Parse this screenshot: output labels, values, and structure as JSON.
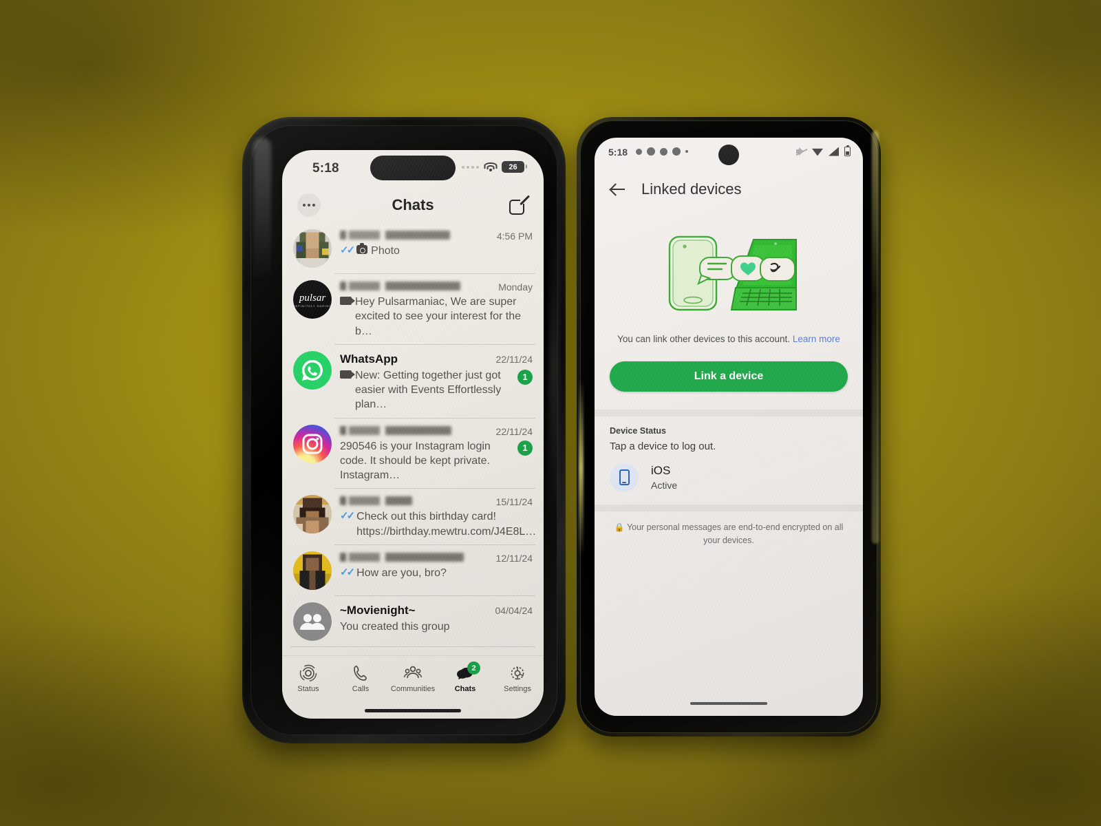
{
  "scene": {
    "background_color": "#9d8c14",
    "description": "Two smartphones side by side on an olive-yellow desk"
  },
  "ios_phone": {
    "status_bar": {
      "time": "5:18",
      "battery_level": "26",
      "icons": [
        "signal-dots-icon",
        "wifi-icon",
        "battery-icon"
      ]
    },
    "nav": {
      "menu_label": "",
      "title": "Chats",
      "compose_label": ""
    },
    "chats": [
      {
        "name": "",
        "name_redacted": true,
        "time": "4:56 PM",
        "message": "Photo",
        "ticks": true,
        "icon": "photo-icon",
        "badge": "",
        "avatar_type": "pixelated-person",
        "avatar_colors": [
          "#6d7a4a",
          "#caa57a",
          "#2b3a6e",
          "#d8c24a"
        ]
      },
      {
        "name": "",
        "name_redacted": true,
        "time": "Monday",
        "message": "Hey Pulsarmaniac,  We are super excited to see your interest for the b…",
        "ticks": false,
        "icon": "video-icon",
        "badge": "",
        "avatar_type": "pulsar-logo"
      },
      {
        "name": "WhatsApp",
        "name_redacted": false,
        "time": "22/11/24",
        "message": "New: Getting together just got easier with Events Effortlessly plan…",
        "ticks": false,
        "icon": "video-icon",
        "badge": "1",
        "avatar_type": "whatsapp-logo"
      },
      {
        "name": "",
        "name_redacted": true,
        "time": "22/11/24",
        "message": "290546 is your Instagram login code. It should be kept private. Instagram…",
        "ticks": false,
        "icon": "video-icon",
        "badge": "1",
        "avatar_type": "instagram-logo"
      },
      {
        "name": "",
        "name_redacted": true,
        "time": "15/11/24",
        "message": "Check out this birthday card! https://birthday.mewtru.com/J4E8L…",
        "ticks": true,
        "icon": "",
        "badge": "",
        "avatar_type": "pixelated-person",
        "avatar_colors": [
          "#d9a24e",
          "#4b3224",
          "#8c6a4a",
          "#2a1c14"
        ]
      },
      {
        "name": "",
        "name_redacted": true,
        "time": "12/11/24",
        "message": "How are you, bro?",
        "ticks": true,
        "icon": "",
        "badge": "",
        "avatar_type": "pixelated-person",
        "avatar_colors": [
          "#e8c01c",
          "#2b2b2b",
          "#7a5a3a",
          "#141414"
        ]
      },
      {
        "name": "~Movienight~",
        "name_redacted": false,
        "time": "04/04/24",
        "message": "You created this group",
        "ticks": false,
        "icon": "",
        "badge": "",
        "avatar_type": "group-icon"
      }
    ],
    "tabs": [
      {
        "label": "Status",
        "icon": "status-rings-icon",
        "active": false,
        "badge": ""
      },
      {
        "label": "Calls",
        "icon": "phone-icon",
        "active": false,
        "badge": ""
      },
      {
        "label": "Communities",
        "icon": "communities-icon",
        "active": false,
        "badge": ""
      },
      {
        "label": "Chats",
        "icon": "chats-bubble-icon",
        "active": true,
        "badge": "2"
      },
      {
        "label": "Settings",
        "icon": "gear-icon",
        "active": false,
        "badge": ""
      }
    ],
    "accent_color": "#18a44a",
    "tick_color": "#4a9bf5"
  },
  "android_phone": {
    "status_bar": {
      "time": "5:18",
      "icons": [
        "mute-icon",
        "wifi-icon",
        "signal-icon",
        "battery-icon"
      ]
    },
    "appbar": {
      "back_icon": "back-arrow-icon",
      "title": "Linked devices"
    },
    "hero": {
      "illustration": "phone-to-laptop-link-illustration"
    },
    "description": "You can link other devices to this account.",
    "learn_more": "Learn more",
    "link_button": "Link a device",
    "device_status_label": "Device Status",
    "device_status_hint": "Tap a device to log out.",
    "devices": [
      {
        "name": "iOS",
        "state": "Active",
        "icon": "mobile-device-icon"
      }
    ],
    "encryption_notice": "Your personal messages are end-to-end encrypted on all your devices.",
    "encryption_icon": "lock-icon",
    "accent_color": "#1faa4b",
    "link_color": "#5d7fd6"
  }
}
